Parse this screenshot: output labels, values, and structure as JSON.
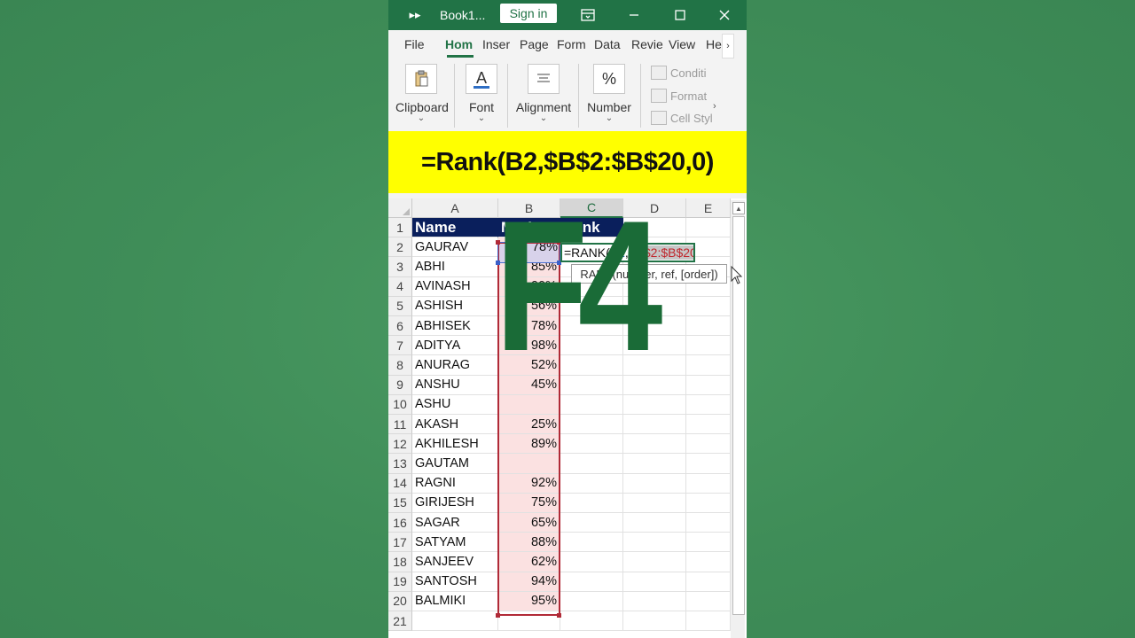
{
  "titlebar": {
    "book_title": "Book1...",
    "sign_in": "Sign in"
  },
  "tabs": [
    "File",
    "Hom",
    "Inser",
    "Page",
    "Form",
    "Data",
    "Revie",
    "View",
    "He"
  ],
  "ribbon": {
    "groups": [
      {
        "label": "Clipboard"
      },
      {
        "label": "Font",
        "icon_text": "A"
      },
      {
        "label": "Alignment"
      },
      {
        "label": "Number",
        "icon_text": "%"
      }
    ],
    "styles": [
      "Conditi",
      "Format",
      "Cell Styl"
    ]
  },
  "banner": "=Rank(B2,$B$2:$B$20,0)",
  "sheet": {
    "columns": [
      "A",
      "B",
      "C",
      "D",
      "E"
    ],
    "header_row": {
      "name": "Name",
      "marks": "Marks",
      "rank": "Rank"
    },
    "rows": [
      {
        "name": "GAURAV",
        "marks": "78%"
      },
      {
        "name": "ABHI",
        "marks": "85%"
      },
      {
        "name": "AVINASH",
        "marks": "90%"
      },
      {
        "name": "ASHISH",
        "marks": "56%"
      },
      {
        "name": "ABHISEK",
        "marks": "78%"
      },
      {
        "name": "ADITYA",
        "marks": "98%"
      },
      {
        "name": "ANURAG",
        "marks": "52%"
      },
      {
        "name": "ANSHU",
        "marks": "45%"
      },
      {
        "name": "ASHU",
        "marks": ""
      },
      {
        "name": "AKASH",
        "marks": "25%"
      },
      {
        "name": "AKHILESH",
        "marks": "89%"
      },
      {
        "name": "GAUTAM",
        "marks": ""
      },
      {
        "name": "RAGNI",
        "marks": "92%"
      },
      {
        "name": "GIRIJESH",
        "marks": "75%"
      },
      {
        "name": "SAGAR",
        "marks": "65%"
      },
      {
        "name": "SATYAM",
        "marks": "88%"
      },
      {
        "name": "SANJEEV",
        "marks": "62%"
      },
      {
        "name": "SANTOSH",
        "marks": "94%"
      },
      {
        "name": "BALMIKI",
        "marks": "95%"
      }
    ],
    "row_numbers": [
      "1",
      "2",
      "3",
      "4",
      "5",
      "6",
      "7",
      "8",
      "9",
      "10",
      "11",
      "12",
      "13",
      "14",
      "15",
      "16",
      "17",
      "18",
      "19",
      "20",
      "21"
    ],
    "editing_formula": {
      "part1": "=RANK(",
      "part2": "B2",
      "part3": ",",
      "part4": "$B$2:$B$20"
    },
    "tooltip": "RANK(number, ref, [order])"
  },
  "overlay_text": "F4",
  "colors": {
    "accent": "#217346",
    "header_fill": "#0a1f5c",
    "banner": "#ffff00",
    "range": "#b02a37"
  }
}
